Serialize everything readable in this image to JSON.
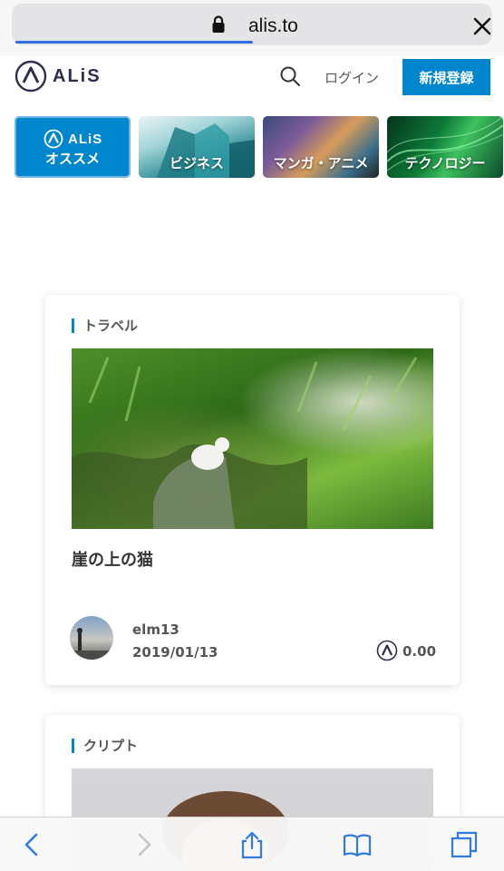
{
  "browser": {
    "url": "alis.to",
    "load_progress": 0.5
  },
  "header": {
    "logo_text": "ALiS",
    "login_label": "ログイン",
    "signup_label": "新規登録"
  },
  "categories": [
    {
      "label": "オススメ",
      "logo_text": "ALiS"
    },
    {
      "label": "ビジネス"
    },
    {
      "label": "マンガ・アニメ"
    },
    {
      "label": "テクノロジー"
    }
  ],
  "articles": [
    {
      "topic": "トラベル",
      "title": "崖の上の猫",
      "author": "elm13",
      "date": "2019/01/13",
      "token_value": "0.00"
    },
    {
      "topic": "クリプト"
    }
  ],
  "colors": {
    "brand": "#0086cc",
    "logo_navy": "#2b2f4c",
    "progress": "#2f6ee0"
  },
  "icons": {
    "lock": "lock-icon",
    "close": "close-icon",
    "search": "search-icon",
    "back": "chevron-left-icon",
    "forward": "chevron-right-icon",
    "share": "share-icon",
    "bookmarks": "book-icon",
    "tabs": "tabs-icon"
  }
}
